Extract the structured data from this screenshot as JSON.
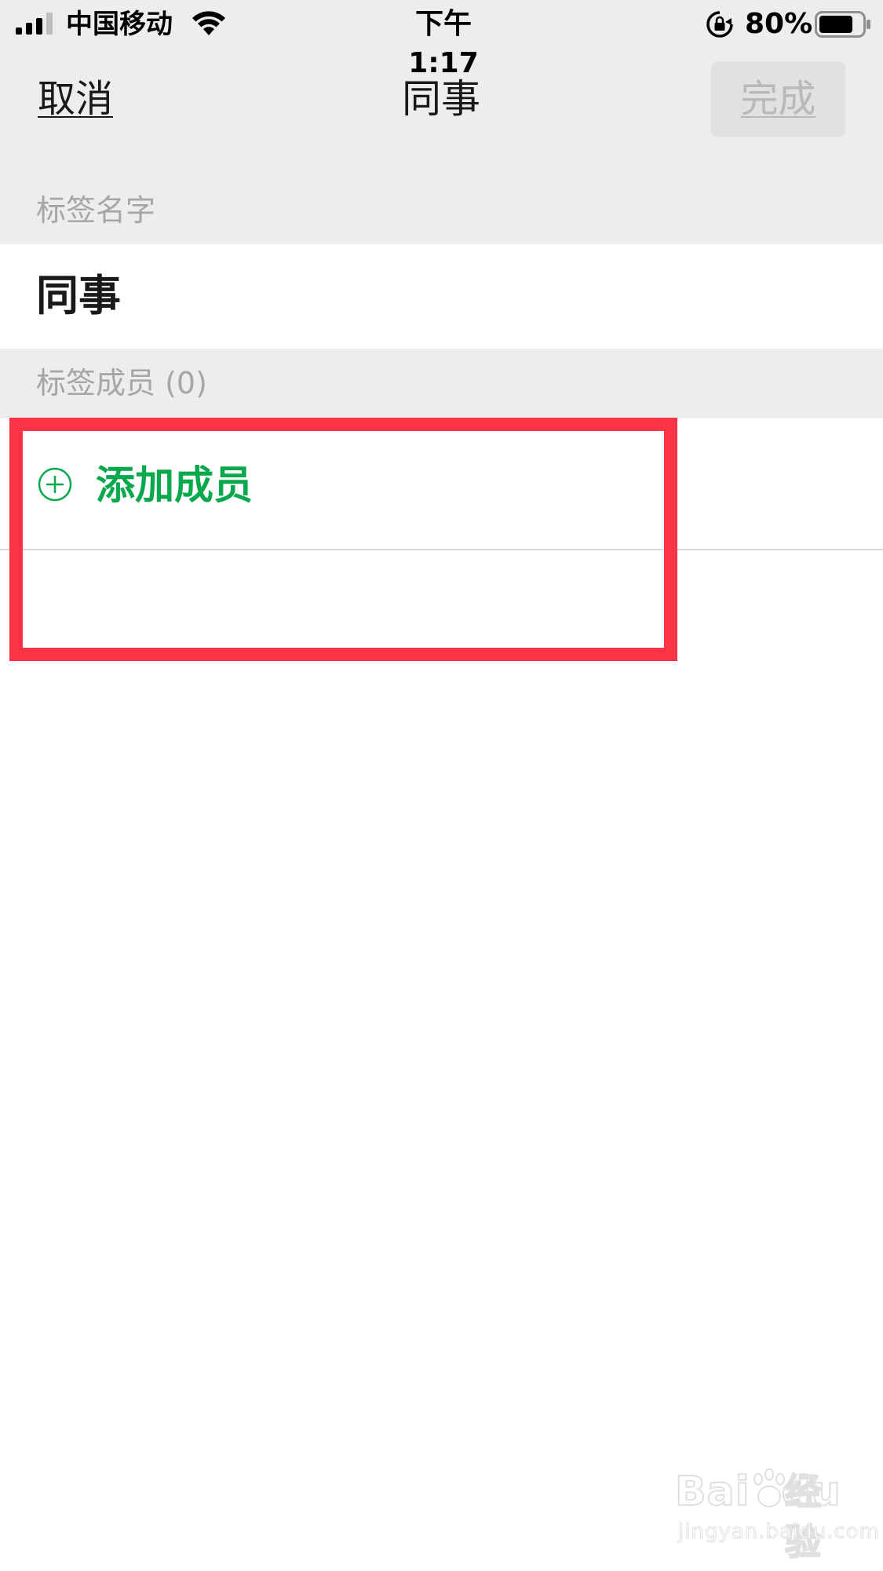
{
  "status_bar": {
    "carrier": "中国移动",
    "time": "下午 1:17",
    "battery_percent": "80%",
    "battery_level": 0.8,
    "icons": [
      "signal-icon",
      "wifi-icon",
      "rotation-lock-icon",
      "battery-icon"
    ]
  },
  "nav": {
    "cancel_label": "取消",
    "title": "同事",
    "done_label": "完成"
  },
  "form": {
    "name_section_label": "标签名字",
    "name_value": "同事",
    "members_section_label": "标签成员 (0)",
    "add_member_label": "添加成员",
    "add_member_icon": "plus-circle-icon"
  },
  "watermark": {
    "logo_text": "Bai",
    "logo_text_tail": "du",
    "cn_text": "经验",
    "url": "jingyan.baidu.com"
  },
  "colors": {
    "accent_green": "#07a94c",
    "highlight_red": "#fb3346",
    "gray_background": "#ededed",
    "disabled_text": "#b9b9b9"
  }
}
